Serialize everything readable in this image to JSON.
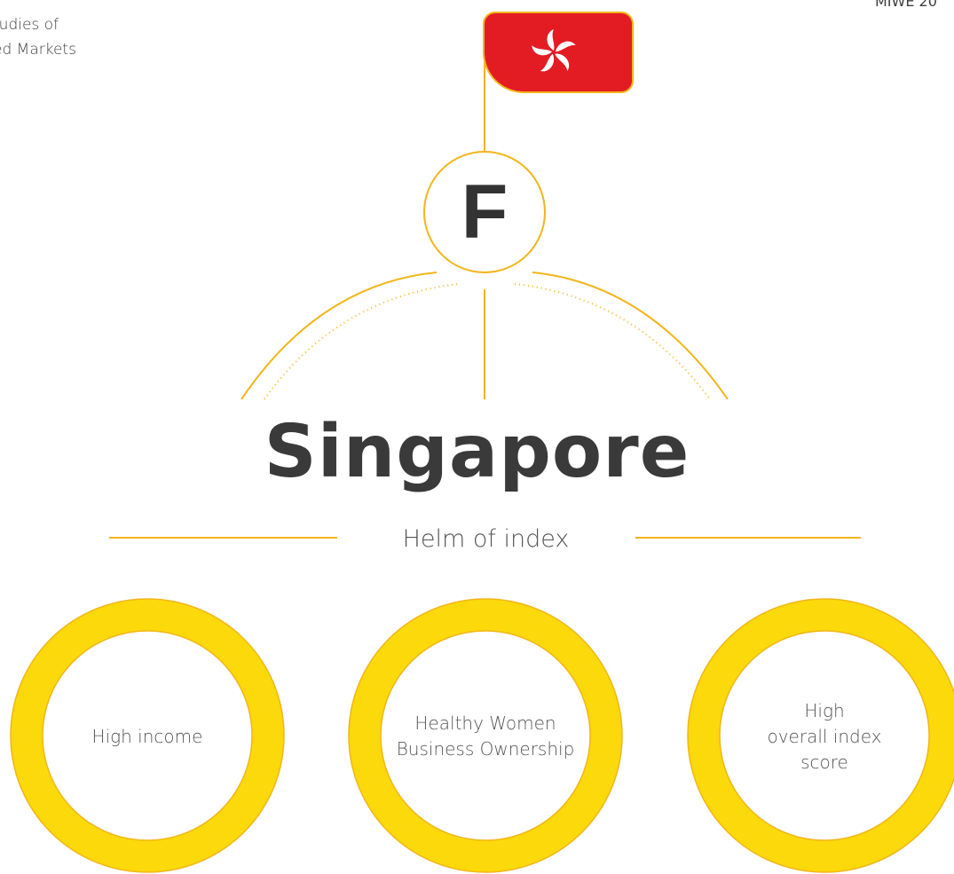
{
  "header": {
    "left_text_line1": "tudies of",
    "left_text_line2": "ed Markets",
    "right_text": "MIWE 20"
  },
  "flag": {
    "name": "Hong Kong",
    "icon": "bauhinia-flower-icon",
    "color": "#e31b23"
  },
  "badge": {
    "letter": "F"
  },
  "title": "Singapore",
  "subtitle": "Helm of index",
  "highlights": [
    {
      "label": "High income"
    },
    {
      "label": "Healthy Women\nBusiness Ownership"
    },
    {
      "label": "High\noverall index\nscore"
    }
  ],
  "colors": {
    "accent": "#f3b51a",
    "ring": "#fbd90a",
    "text": "#3a3a3a"
  }
}
